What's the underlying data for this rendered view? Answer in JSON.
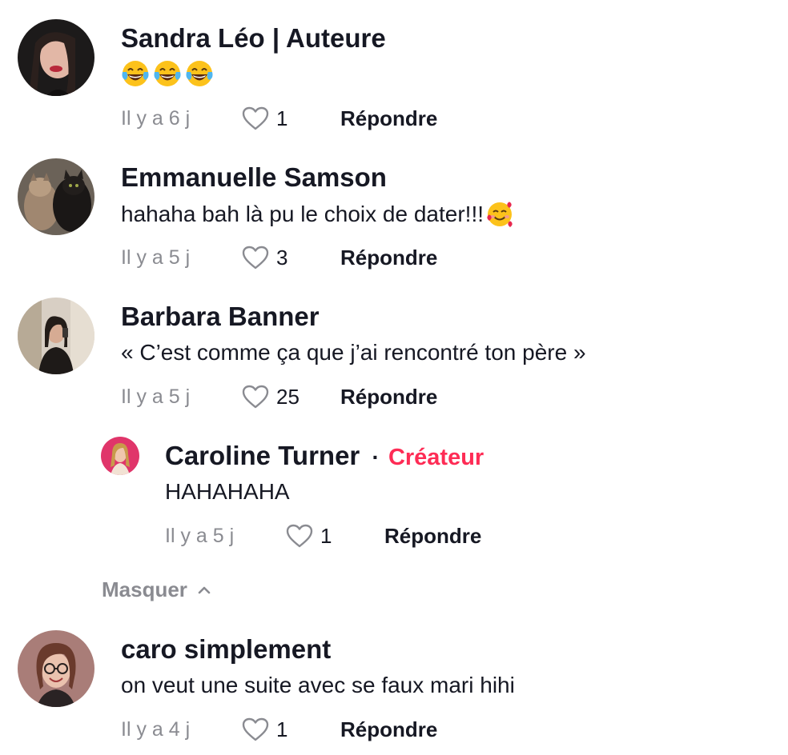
{
  "colors": {
    "text_primary": "#161823",
    "text_secondary": "#8a8b91",
    "creator_accent": "#fe2c55"
  },
  "comments": [
    {
      "author": "Sandra Léo | Auteure",
      "text": "",
      "emoji": [
        "face-with-tears-of-joy",
        "face-with-tears-of-joy",
        "face-with-tears-of-joy"
      ],
      "time": "Il y a 6 j",
      "likes": "1",
      "reply_label": "Répondre"
    },
    {
      "author": "Emmanuelle Samson",
      "text": "hahaha bah là pu le choix de dater!!!",
      "emoji": [
        "smiling-face-with-hearts"
      ],
      "time": "Il y a 5 j",
      "likes": "3",
      "reply_label": "Répondre"
    },
    {
      "author": "Barbara Banner",
      "text": "« C’est comme ça que j’ai rencontré ton père »",
      "time": "Il y a 5 j",
      "likes": "25",
      "reply_label": "Répondre"
    },
    {
      "author": "caro simplement",
      "text": "on veut une suite avec se faux mari hihi",
      "time": "Il y a 4 j",
      "likes": "1",
      "reply_label": "Répondre"
    }
  ],
  "reply": {
    "author": "Caroline Turner",
    "separator": "·",
    "creator_label": "Créateur",
    "text": "HAHAHAHA",
    "time": "Il y a 5 j",
    "likes": "1",
    "reply_label": "Répondre"
  },
  "hide_replies_label": "Masquer",
  "icons": {
    "like": "heart-outline-icon",
    "collapse": "chevron-up-icon"
  }
}
